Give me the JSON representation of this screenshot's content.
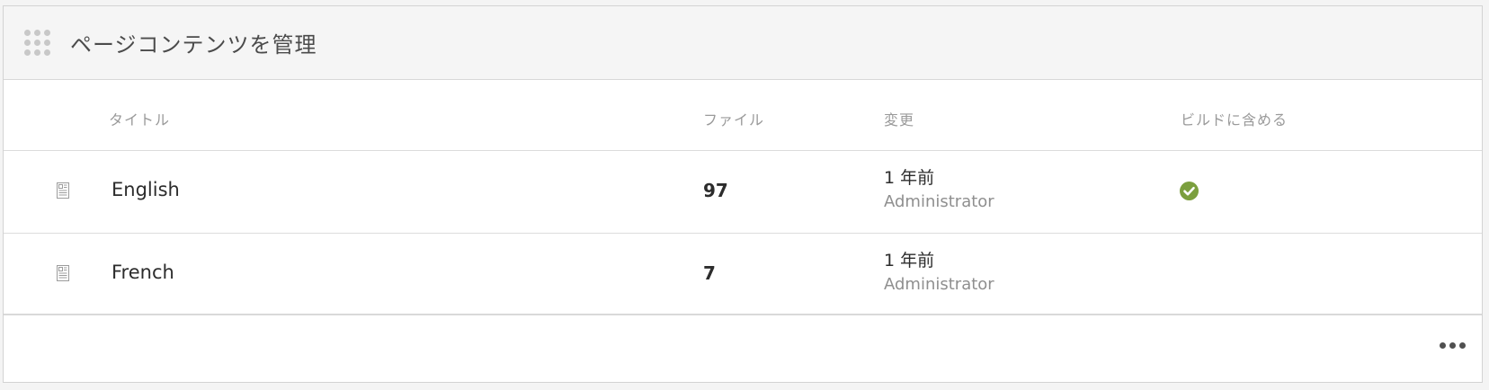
{
  "panel": {
    "title": "ページコンテンツを管理"
  },
  "columns": {
    "title": "タイトル",
    "files": "ファイル",
    "modified": "変更",
    "include_in_build": "ビルドに含める"
  },
  "rows": [
    {
      "title": "English",
      "files": "97",
      "modified_time": "1 年前",
      "modified_by": "Administrator",
      "included_in_build": true,
      "icon": "page-icon"
    },
    {
      "title": "French",
      "files": "7",
      "modified_time": "1 年前",
      "modified_by": "Administrator",
      "included_in_build": false,
      "icon": "page-icon"
    }
  ],
  "colors": {
    "check_green": "#7b9f3e",
    "header_bg": "#f5f5f5"
  },
  "footer": {
    "more_icon": "more-icon"
  }
}
